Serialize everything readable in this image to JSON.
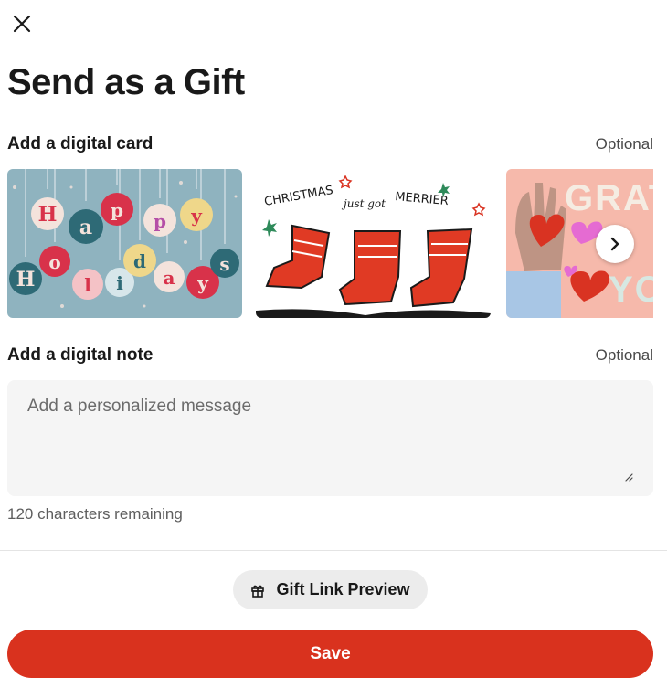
{
  "header": {
    "close_icon": "close-icon",
    "title": "Send as a Gift"
  },
  "digital_card": {
    "heading": "Add a digital card",
    "optional_label": "Optional",
    "cards": [
      {
        "name": "Happy Holidays",
        "art_text": [
          "H",
          "a",
          "p",
          "p",
          "y",
          "H",
          "o",
          "l",
          "i",
          "d",
          "a",
          "y",
          "s"
        ]
      },
      {
        "name": "Christmas just got merrier",
        "art_text": [
          "CHRISTMAS",
          "just got",
          "MERRIER"
        ]
      },
      {
        "name": "Gratitude",
        "art_text": [
          "GRAT",
          "YO"
        ]
      }
    ],
    "next_icon": "chevron-right-icon"
  },
  "digital_note": {
    "heading": "Add a digital note",
    "optional_label": "Optional",
    "placeholder": "Add a personalized message",
    "value": "",
    "remaining_text": "120 characters remaining"
  },
  "actions": {
    "preview_label": "Gift Link Preview",
    "preview_icon": "gift-icon",
    "save_label": "Save"
  },
  "colors": {
    "accent": "#d9321e",
    "card1_bg": "#8fb3bf",
    "card3_bg": "#f6b9ab"
  }
}
